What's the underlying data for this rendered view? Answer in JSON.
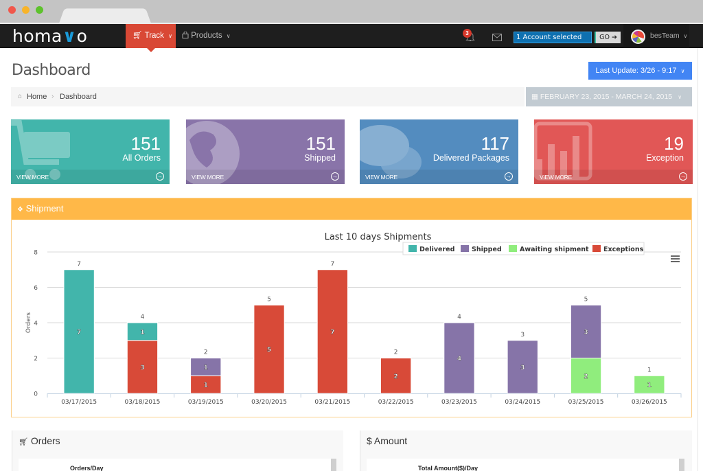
{
  "browser": {
    "window_controls": [
      "close",
      "minimize",
      "maximize"
    ]
  },
  "nav": {
    "logo_prefix": "homa",
    "logo_v": "V",
    "logo_suffix": "o",
    "items": [
      {
        "label": "Track",
        "icon": "cart-icon",
        "active": true
      },
      {
        "label": "Products",
        "icon": "shopping-bag-icon",
        "active": false
      }
    ],
    "notifications_count": "3",
    "account_selector": "1 Account selected",
    "go_label": "GO",
    "username": "besTeam"
  },
  "header": {
    "title": "Dashboard",
    "last_update": "Last Update: 3/26 - 9:17",
    "breadcrumb": [
      "Home",
      "Dashboard"
    ],
    "date_range": "FEBRUARY 23, 2015 - MARCH 24, 2015"
  },
  "tiles": [
    {
      "value": "151",
      "label": "All Orders",
      "link": "VIEW MORE",
      "icon": "shopping-cart-icon",
      "color": "#42b5ab"
    },
    {
      "value": "151",
      "label": "Shipped",
      "link": "VIEW MORE",
      "icon": "globe-icon",
      "color": "#8974a9"
    },
    {
      "value": "117",
      "label": "Delivered Packages",
      "link": "VIEW MORE",
      "icon": "chat-bubbles-icon",
      "color": "#538cbf"
    },
    {
      "value": "19",
      "label": "Exception",
      "link": "VIEW MORE",
      "icon": "bar-chart-icon",
      "color": "#e15756"
    }
  ],
  "shipment_panel": {
    "title": "Shipment"
  },
  "chart_data": {
    "type": "bar",
    "stacked": true,
    "title": "Last 10 days Shipments",
    "xlabel": "",
    "ylabel": "Orders",
    "ylim": [
      0,
      8
    ],
    "yticks": [
      0,
      2,
      4,
      6,
      8
    ],
    "grid": true,
    "legend_position": "top-right",
    "categories": [
      "03/17/2015",
      "03/18/2015",
      "03/19/2015",
      "03/20/2015",
      "03/21/2015",
      "03/22/2015",
      "03/23/2015",
      "03/24/2015",
      "03/25/2015",
      "03/26/2015"
    ],
    "series": [
      {
        "name": "Delivered",
        "color": "#42b5ab",
        "values": [
          7,
          1,
          0,
          0,
          0,
          0,
          0,
          0,
          0,
          0
        ]
      },
      {
        "name": "Shipped",
        "color": "#8674a8",
        "values": [
          0,
          0,
          1,
          0,
          0,
          0,
          4,
          3,
          3,
          0
        ]
      },
      {
        "name": "Awaiting shipment",
        "color": "#90ed7d",
        "values": [
          0,
          0,
          0,
          0,
          0,
          0,
          0,
          0,
          2,
          1
        ]
      },
      {
        "name": "Exceptions",
        "color": "#d84a38",
        "values": [
          0,
          3,
          1,
          5,
          7,
          2,
          0,
          0,
          0,
          0
        ]
      }
    ],
    "totals": [
      7,
      4,
      2,
      5,
      7,
      2,
      4,
      3,
      5,
      1
    ]
  },
  "bottom_panels": [
    {
      "title": "Orders",
      "icon": "cart-icon",
      "subtitle": "Orders/Day"
    },
    {
      "title": "Amount",
      "icon": "dollar-icon",
      "subtitle": "Total Amount($)/Day"
    }
  ]
}
